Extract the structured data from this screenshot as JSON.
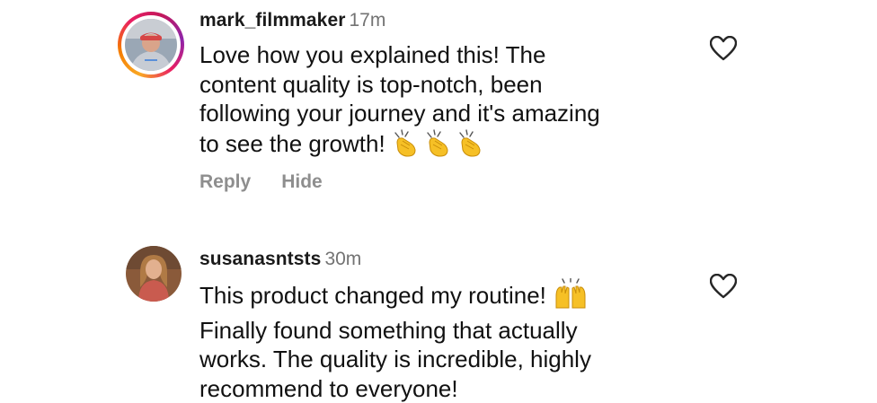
{
  "comments": [
    {
      "username": "mark_filmmaker",
      "time": "17m",
      "text_lines": [
        "Love how you explained this! The",
        "content quality is top-notch, been",
        "following your journey and it's amazing",
        "to see the growth!"
      ],
      "emoji": [
        "clapping-hands",
        "clapping-hands",
        "clapping-hands"
      ],
      "has_story_ring": true,
      "actions": {
        "reply": "Reply",
        "hide": "Hide"
      }
    },
    {
      "username": "susanasntsts",
      "time": "30m",
      "text_lines": [
        "This product changed my routine!",
        "Finally found something that actually",
        "works. The quality is incredible, highly",
        "recommend to everyone!"
      ],
      "emoji": [
        "raising-hands"
      ],
      "has_story_ring": false
    }
  ],
  "colors": {
    "text": "#111111",
    "secondary": "#737373",
    "action": "#8e8e8e",
    "emoji_yellow": "#f6c026"
  },
  "icons": {
    "like": "heart-outline-icon"
  }
}
